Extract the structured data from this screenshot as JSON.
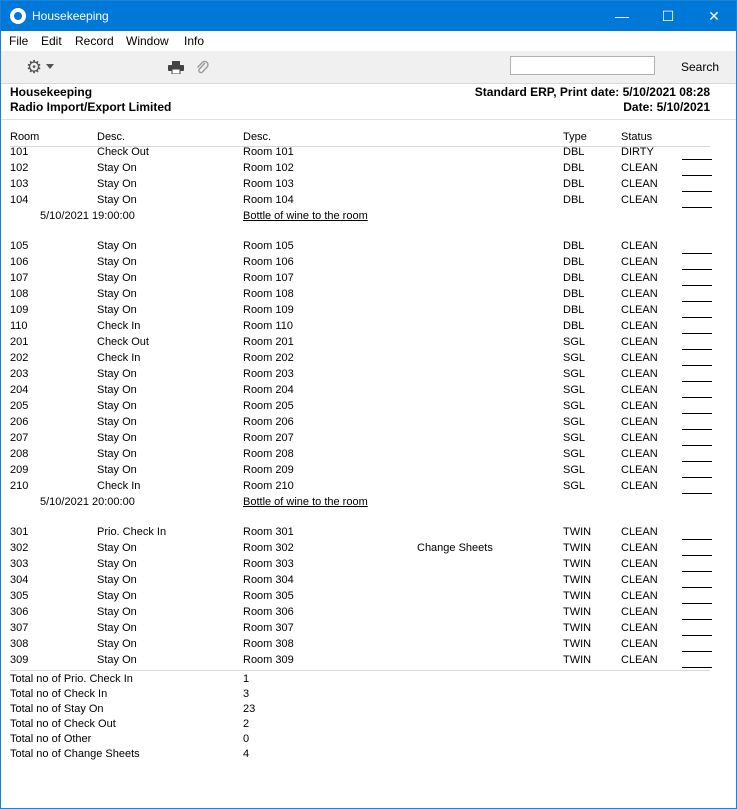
{
  "window": {
    "title": "Housekeeping",
    "controls": {
      "minimize": "—",
      "maximize": "☐",
      "close": "✕"
    }
  },
  "menu": [
    "File",
    "Edit",
    "Record",
    "Window",
    "Info"
  ],
  "toolbar": {
    "search_label": "Search",
    "search_value": ""
  },
  "report_header": {
    "title": "Housekeeping",
    "company": "Radio Import/Export Limited",
    "system_print": "Standard ERP, Print date: 5/10/2021 08:28",
    "date": "Date: 5/10/2021"
  },
  "columns": {
    "room": "Room",
    "desc1": "Desc.",
    "desc2": "Desc.",
    "type": "Type",
    "status": "Status"
  },
  "rows": [
    {
      "room": "101",
      "desc1": "Check Out",
      "desc2": "Room 101",
      "extra": "",
      "type": "DBL",
      "status": "DIRTY"
    },
    {
      "room": "102",
      "desc1": "Stay On",
      "desc2": "Room 102",
      "extra": "",
      "type": "DBL",
      "status": "CLEAN"
    },
    {
      "room": "103",
      "desc1": "Stay On",
      "desc2": "Room 103",
      "extra": "",
      "type": "DBL",
      "status": "CLEAN"
    },
    {
      "room": "104",
      "desc1": "Stay On",
      "desc2": "Room 104",
      "extra": "",
      "type": "DBL",
      "status": "CLEAN"
    },
    {
      "note_time": "5/10/2021 19:00:00",
      "note_text": "Bottle of wine to the room"
    },
    {
      "room": "105",
      "desc1": "Stay On",
      "desc2": "Room 105",
      "extra": "",
      "type": "DBL",
      "status": "CLEAN"
    },
    {
      "room": "106",
      "desc1": "Stay On",
      "desc2": "Room 106",
      "extra": "",
      "type": "DBL",
      "status": "CLEAN"
    },
    {
      "room": "107",
      "desc1": "Stay On",
      "desc2": "Room 107",
      "extra": "",
      "type": "DBL",
      "status": "CLEAN"
    },
    {
      "room": "108",
      "desc1": "Stay On",
      "desc2": "Room 108",
      "extra": "",
      "type": "DBL",
      "status": "CLEAN"
    },
    {
      "room": "109",
      "desc1": "Stay On",
      "desc2": "Room 109",
      "extra": "",
      "type": "DBL",
      "status": "CLEAN"
    },
    {
      "room": "110",
      "desc1": "Check In",
      "desc2": "Room 110",
      "extra": "",
      "type": "DBL",
      "status": "CLEAN"
    },
    {
      "room": "201",
      "desc1": "Check Out",
      "desc2": "Room 201",
      "extra": "",
      "type": "SGL",
      "status": "CLEAN"
    },
    {
      "room": "202",
      "desc1": "Check In",
      "desc2": "Room 202",
      "extra": "",
      "type": "SGL",
      "status": "CLEAN"
    },
    {
      "room": "203",
      "desc1": "Stay On",
      "desc2": "Room 203",
      "extra": "",
      "type": "SGL",
      "status": "CLEAN"
    },
    {
      "room": "204",
      "desc1": "Stay On",
      "desc2": "Room 204",
      "extra": "",
      "type": "SGL",
      "status": "CLEAN"
    },
    {
      "room": "205",
      "desc1": "Stay On",
      "desc2": "Room 205",
      "extra": "",
      "type": "SGL",
      "status": "CLEAN"
    },
    {
      "room": "206",
      "desc1": "Stay On",
      "desc2": "Room 206",
      "extra": "",
      "type": "SGL",
      "status": "CLEAN"
    },
    {
      "room": "207",
      "desc1": "Stay On",
      "desc2": "Room 207",
      "extra": "",
      "type": "SGL",
      "status": "CLEAN"
    },
    {
      "room": "208",
      "desc1": "Stay On",
      "desc2": "Room 208",
      "extra": "",
      "type": "SGL",
      "status": "CLEAN"
    },
    {
      "room": "209",
      "desc1": "Stay On",
      "desc2": "Room 209",
      "extra": "",
      "type": "SGL",
      "status": "CLEAN"
    },
    {
      "room": "210",
      "desc1": "Check In",
      "desc2": "Room 210",
      "extra": "",
      "type": "SGL",
      "status": "CLEAN"
    },
    {
      "note_time": "5/10/2021 20:00:00",
      "note_text": "Bottle of wine to the room"
    },
    {
      "room": "301",
      "desc1": "Prio. Check In",
      "desc2": "Room 301",
      "extra": "",
      "type": "TWIN",
      "status": "CLEAN"
    },
    {
      "room": "302",
      "desc1": "Stay On",
      "desc2": "Room 302",
      "extra": "Change Sheets",
      "type": "TWIN",
      "status": "CLEAN"
    },
    {
      "room": "303",
      "desc1": "Stay On",
      "desc2": "Room 303",
      "extra": "",
      "type": "TWIN",
      "status": "CLEAN"
    },
    {
      "room": "304",
      "desc1": "Stay On",
      "desc2": "Room 304",
      "extra": "",
      "type": "TWIN",
      "status": "CLEAN"
    },
    {
      "room": "305",
      "desc1": "Stay On",
      "desc2": "Room 305",
      "extra": "",
      "type": "TWIN",
      "status": "CLEAN"
    },
    {
      "room": "306",
      "desc1": "Stay On",
      "desc2": "Room 306",
      "extra": "",
      "type": "TWIN",
      "status": "CLEAN"
    },
    {
      "room": "307",
      "desc1": "Stay On",
      "desc2": "Room 307",
      "extra": "",
      "type": "TWIN",
      "status": "CLEAN"
    },
    {
      "room": "308",
      "desc1": "Stay On",
      "desc2": "Room 308",
      "extra": "",
      "type": "TWIN",
      "status": "CLEAN"
    },
    {
      "room": "309",
      "desc1": "Stay On",
      "desc2": "Room 309",
      "extra": "",
      "type": "TWIN",
      "status": "CLEAN"
    }
  ],
  "totals": [
    {
      "label": "Total no of Prio. Check In",
      "value": "1"
    },
    {
      "label": "Total no of Check In",
      "value": "3"
    },
    {
      "label": "Total no of Stay On",
      "value": "23"
    },
    {
      "label": "Total no of Check Out",
      "value": "2"
    },
    {
      "label": "Total no of Other",
      "value": "0"
    },
    {
      "label": "Total no of Change Sheets",
      "value": "4"
    }
  ],
  "colors": {
    "titlebar": "#0078d7",
    "toolbar": "#f0f0f0"
  },
  "icons": [
    "app-icon",
    "gear-icon",
    "print-icon",
    "attachment-icon"
  ]
}
